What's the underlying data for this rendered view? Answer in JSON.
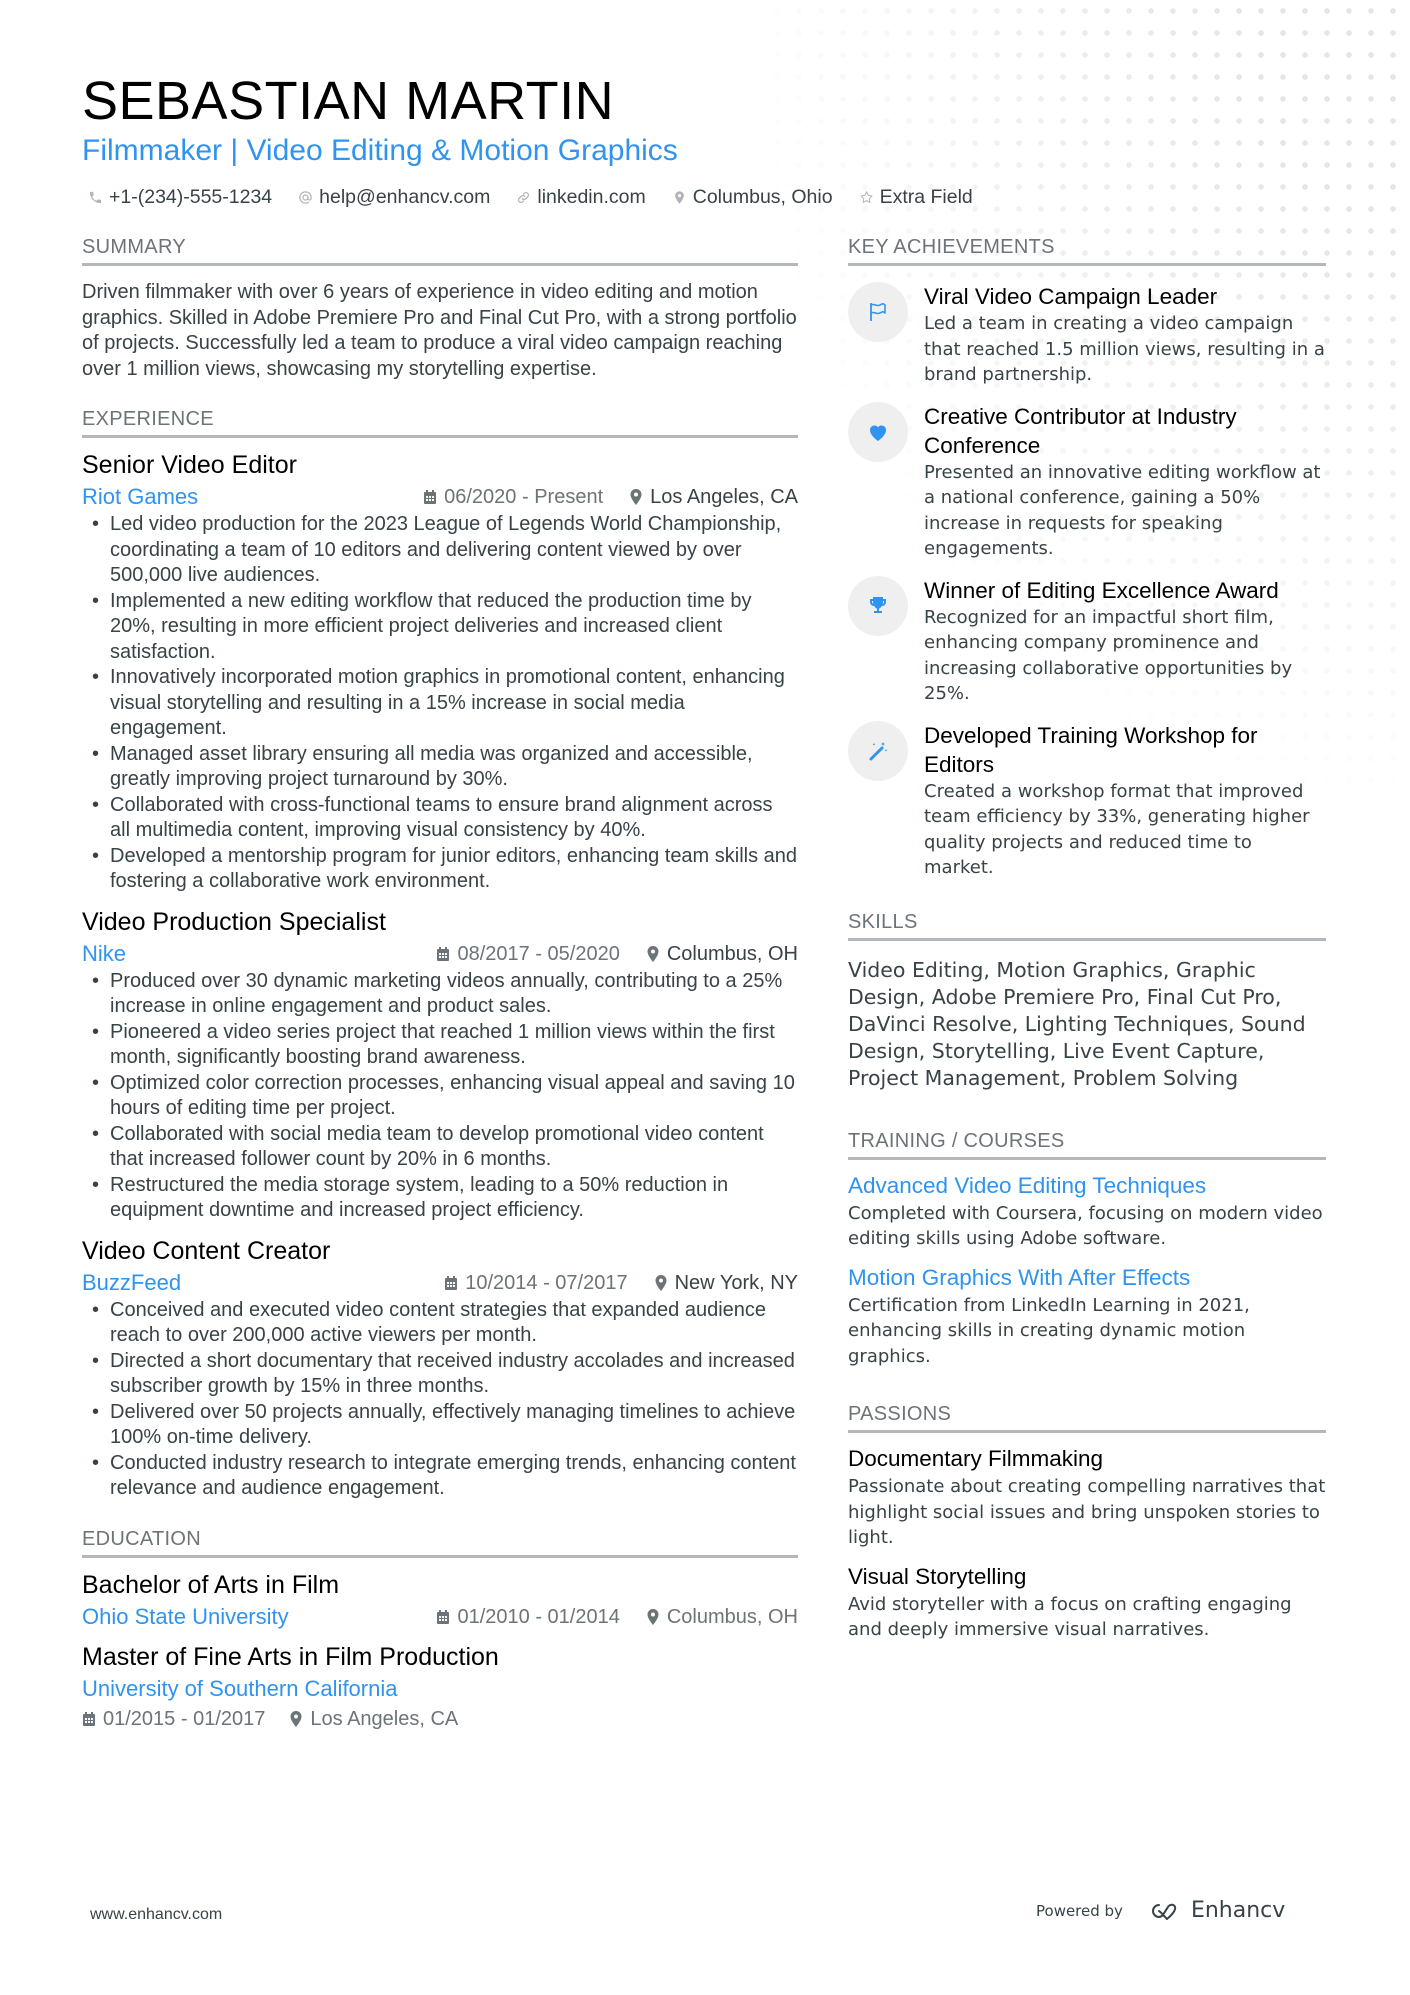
{
  "header": {
    "name": "SEBASTIAN MARTIN",
    "title": "Filmmaker | Video Editing & Motion Graphics",
    "contacts": [
      {
        "icon": "phone-icon",
        "text": "+1-(234)-555-1234"
      },
      {
        "icon": "at-icon",
        "text": "help@enhancv.com"
      },
      {
        "icon": "link-icon",
        "text": "linkedin.com"
      },
      {
        "icon": "location-pin-icon",
        "text": "Columbus, Ohio"
      },
      {
        "icon": "star-icon",
        "text": "Extra Field"
      }
    ]
  },
  "colors": {
    "accent": "#2f93f0",
    "text": "#384347",
    "muted": "#6b7478",
    "divider": "#b4b8ba",
    "icon_bg": "#efefef"
  },
  "summary": {
    "heading": "SUMMARY",
    "text": "Driven filmmaker with over 6 years of experience in video editing and motion graphics. Skilled in Adobe Premiere Pro and Final Cut Pro, with a strong portfolio of projects. Successfully led a team to produce a viral video campaign reaching over 1 million views, showcasing my storytelling expertise."
  },
  "experience": {
    "heading": "EXPERIENCE",
    "jobs": [
      {
        "title": "Senior Video Editor",
        "company": "Riot Games",
        "dates": "06/2020 - Present",
        "location": "Los Angeles, CA",
        "bullets": [
          "Led video production for the 2023 League of Legends World Championship, coordinating a team of 10 editors and delivering content viewed by over 500,000 live audiences.",
          "Implemented a new editing workflow that reduced the production time by 20%, resulting in more efficient project deliveries and increased client satisfaction.",
          "Innovatively incorporated motion graphics in promotional content, enhancing visual storytelling and resulting in a 15% increase in social media engagement.",
          "Managed asset library ensuring all media was organized and accessible, greatly improving project turnaround by 30%.",
          "Collaborated with cross-functional teams to ensure brand alignment across all multimedia content, improving visual consistency by 40%.",
          "Developed a mentorship program for junior editors, enhancing team skills and fostering a collaborative work environment."
        ]
      },
      {
        "title": "Video Production Specialist",
        "company": "Nike",
        "dates": "08/2017 - 05/2020",
        "location": "Columbus, OH",
        "bullets": [
          "Produced over 30 dynamic marketing videos annually, contributing to a 25% increase in online engagement and product sales.",
          "Pioneered a video series project that reached 1 million views within the first month, significantly boosting brand awareness.",
          "Optimized color correction processes, enhancing visual appeal and saving 10 hours of editing time per project.",
          "Collaborated with social media team to develop promotional video content that increased follower count by 20% in 6 months.",
          "Restructured the media storage system, leading to a 50% reduction in equipment downtime and increased project efficiency."
        ]
      },
      {
        "title": "Video Content Creator",
        "company": "BuzzFeed",
        "dates": "10/2014 - 07/2017",
        "location": "New York, NY",
        "bullets": [
          "Conceived and executed video content strategies that expanded audience reach to over 200,000 active viewers per month.",
          "Directed a short documentary that received industry accolades and increased subscriber growth by 15% in three months.",
          "Delivered over 50 projects annually, effectively managing timelines to achieve 100% on-time delivery.",
          "Conducted industry research to integrate emerging trends, enhancing content relevance and audience engagement."
        ]
      }
    ]
  },
  "education": {
    "heading": "EDUCATION",
    "items": [
      {
        "degree": "Bachelor of Arts in Film",
        "school": "Ohio State University",
        "dates": "01/2010 - 01/2014",
        "location": "Columbus, OH"
      },
      {
        "degree": "Master of Fine Arts in Film Production",
        "school": "University of Southern California",
        "dates": "01/2015 - 01/2017",
        "location": "Los Angeles, CA"
      }
    ]
  },
  "achievements": {
    "heading": "KEY ACHIEVEMENTS",
    "items": [
      {
        "icon": "flag-icon",
        "title": "Viral Video Campaign Leader",
        "desc": "Led a team in creating a video campaign that reached 1.5 million views, resulting in a brand partnership."
      },
      {
        "icon": "heart-icon",
        "title": "Creative Contributor at Industry Conference",
        "desc": "Presented an innovative editing workflow at a national conference, gaining a 50% increase in requests for speaking engagements."
      },
      {
        "icon": "trophy-icon",
        "title": "Winner of Editing Excellence Award",
        "desc": "Recognized for an impactful short film, enhancing company prominence and increasing collaborative opportunities by 25%."
      },
      {
        "icon": "magic-wand-icon",
        "title": "Developed Training Workshop for Editors",
        "desc": "Created a workshop format that improved team efficiency by 33%, generating higher quality projects and reduced time to market."
      }
    ]
  },
  "skills": {
    "heading": "SKILLS",
    "text": "Video Editing, Motion Graphics, Graphic Design, Adobe Premiere Pro, Final Cut Pro, DaVinci Resolve, Lighting Techniques, Sound Design, Storytelling, Live Event Capture, Project Management, Problem Solving"
  },
  "training": {
    "heading": "TRAINING / COURSES",
    "items": [
      {
        "title": "Advanced Video Editing Techniques",
        "desc": "Completed with Coursera, focusing on modern video editing skills using Adobe software."
      },
      {
        "title": "Motion Graphics With After Effects",
        "desc": "Certification from LinkedIn Learning in 2021, enhancing skills in creating dynamic motion graphics."
      }
    ]
  },
  "passions": {
    "heading": "PASSIONS",
    "items": [
      {
        "title": "Documentary Filmmaking",
        "desc": "Passionate about creating compelling narratives that highlight social issues and bring unspoken stories to light."
      },
      {
        "title": "Visual Storytelling",
        "desc": "Avid storyteller with a focus on crafting engaging and deeply immersive visual narratives."
      }
    ]
  },
  "footer": {
    "website": "www.enhancv.com",
    "powered_by": "Powered by",
    "brand": "Enhancv"
  }
}
